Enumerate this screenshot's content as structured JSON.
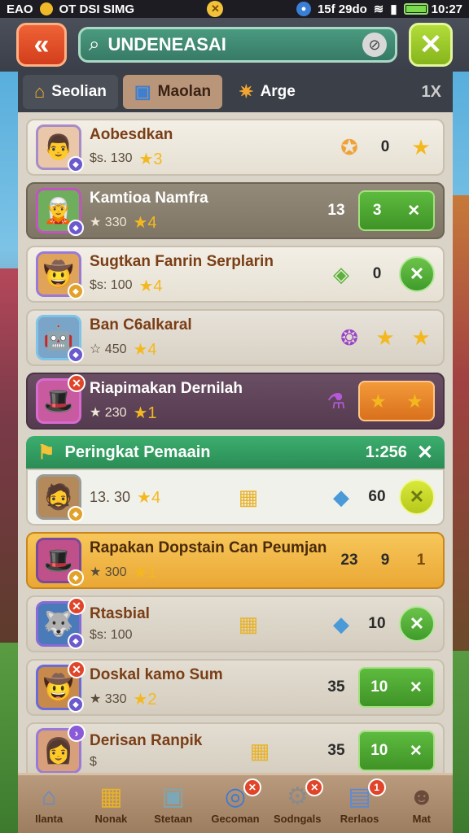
{
  "status_bar": {
    "left_text": "EAO",
    "carrier": "OT DSI SIMG",
    "mid_badge": "✕",
    "network": "15f 29do",
    "time": "10:27",
    "colors": {
      "battery": "#7bd94e"
    }
  },
  "header": {
    "back_icon": "back-arrow-icon",
    "search_value": "UNDENEASAI",
    "clear_icon": "clear-icon",
    "close_label": "✕"
  },
  "tabs": [
    {
      "label": "Seolian",
      "icon": "house-icon"
    },
    {
      "label": "Maolan",
      "icon": "box-icon"
    },
    {
      "label": "Arge",
      "icon": "star-icon"
    }
  ],
  "tabs_extra": "1X",
  "rows": [
    {
      "name": "Aobesdkan",
      "price": "$s. 130",
      "stars": "★3",
      "mid_num": "0",
      "action": "★"
    },
    {
      "name": "Kamtioa Namfra",
      "price": "★ 330",
      "stars": "★4",
      "mid_num": "13",
      "btn_num": "3",
      "btn_x": "✕"
    },
    {
      "name": "Sugtkan Fanrin Serplarin",
      "price": "$s: 100",
      "stars": "★4",
      "mid_num": "0",
      "btn_x": "✕"
    },
    {
      "name": "Ban C6alkaral",
      "price": "☆ 450",
      "stars": "★4",
      "action": "★"
    },
    {
      "name": "Riapimakan Dernilah",
      "price": "★ 230",
      "stars": "★1"
    }
  ],
  "section": {
    "title": "Peringkat Pemaain",
    "count": "1:256",
    "close": "✕"
  },
  "section_row": {
    "price": "13. 30",
    "stars": "★4",
    "num": "60",
    "btn_x": "✕"
  },
  "rows2": [
    {
      "name": "Rapakan Dopstain Can Peumjan",
      "price": "★ 300",
      "stars": "★1",
      "n1": "23",
      "n2": "9",
      "n3": "1"
    },
    {
      "name": "Rtasbial",
      "price": "$s: 100",
      "num": "10",
      "btn_x": "✕"
    },
    {
      "name": "Doskal kamo Sum",
      "price": "★ 330",
      "stars": "★2",
      "n1": "35",
      "btn_num": "10",
      "btn_x": "✕"
    },
    {
      "name": "Derisan Ranpik",
      "price": "$",
      "n1": "35",
      "btn_num": "10",
      "btn_x": "✕"
    }
  ],
  "bottom_nav": [
    {
      "label": "Ilanta",
      "icon": "house-icon"
    },
    {
      "label": "Nonak",
      "icon": "chest-icon"
    },
    {
      "label": "Stetaan",
      "icon": "box-icon"
    },
    {
      "label": "Gecoman",
      "icon": "target-icon",
      "badge": "✕"
    },
    {
      "label": "Sodngals",
      "icon": "gear-icon",
      "badge": "✕"
    },
    {
      "label": "Rerlaos",
      "icon": "map-icon",
      "badge": "1"
    },
    {
      "label": "Mat",
      "icon": "person-icon"
    }
  ]
}
